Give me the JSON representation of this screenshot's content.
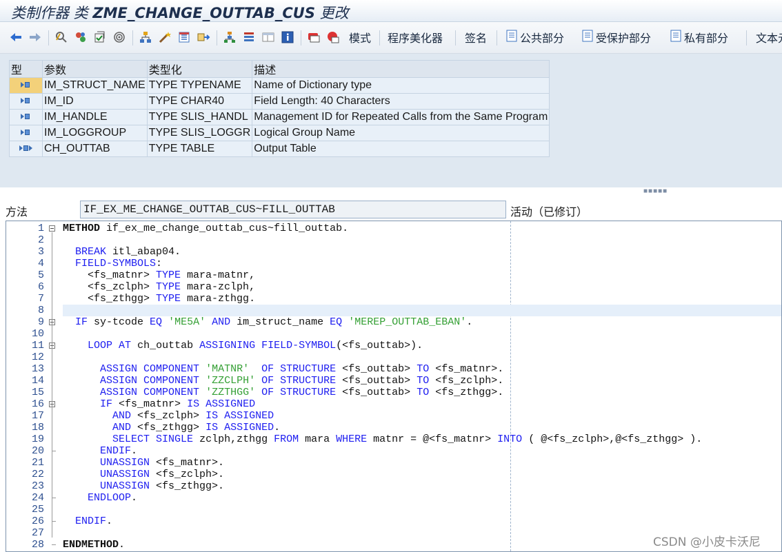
{
  "title": {
    "prefix": "类制作器 类 ",
    "class_name": "ZME_CHANGE_OUTTAB_CUS",
    "suffix": " 更改"
  },
  "toolbar": {
    "mode_label": "模式",
    "pretty_printer_label": "程序美化器",
    "signature_label": "签名",
    "public_section_label": "公共部分",
    "protected_section_label": "受保护部分",
    "private_section_label": "私有部分",
    "text_label": "文本元"
  },
  "params": {
    "headers": [
      "型",
      "参数",
      "类型化",
      "描述"
    ],
    "rows": [
      {
        "icon": "importing-param-icon",
        "name": "IM_STRUCT_NAME",
        "typing": "TYPE TYPENAME",
        "desc": "Name of Dictionary type"
      },
      {
        "icon": "importing-param-icon",
        "name": "IM_ID",
        "typing": "TYPE CHAR40",
        "desc": "Field Length: 40 Characters"
      },
      {
        "icon": "importing-param-icon",
        "name": "IM_HANDLE",
        "typing": "TYPE SLIS_HANDL",
        "desc": "Management ID for Repeated Calls from the Same Program"
      },
      {
        "icon": "importing-param-icon",
        "name": "IM_LOGGROUP",
        "typing": "TYPE SLIS_LOGGR",
        "desc": "Logical Group Name"
      },
      {
        "icon": "changing-param-icon",
        "name": "CH_OUTTAB",
        "typing": "TYPE TABLE",
        "desc": "Output Table"
      }
    ]
  },
  "method": {
    "label": "方法",
    "name": "IF_EX_ME_CHANGE_OUTTAB_CUS~FILL_OUTTAB",
    "status": "活动（已修订）"
  },
  "code_lines": [
    {
      "n": "1",
      "t": "METHOD if_ex_me_change_outtab_cus~fill_outtab."
    },
    {
      "n": "2",
      "t": ""
    },
    {
      "n": "3",
      "t": "  BREAK itl_abap04."
    },
    {
      "n": "4",
      "t": "  FIELD-SYMBOLS:"
    },
    {
      "n": "5",
      "t": "    <fs_matnr> TYPE mara-matnr,"
    },
    {
      "n": "6",
      "t": "    <fs_zclph> TYPE mara-zclph,"
    },
    {
      "n": "7",
      "t": "    <fs_zthgg> TYPE mara-zthgg."
    },
    {
      "n": "8",
      "t": ""
    },
    {
      "n": "9",
      "t": "  IF sy-tcode EQ 'ME5A' AND im_struct_name EQ 'MEREP_OUTTAB_EBAN'."
    },
    {
      "n": "10",
      "t": ""
    },
    {
      "n": "11",
      "t": "    LOOP AT ch_outtab ASSIGNING FIELD-SYMBOL(<fs_outtab>)."
    },
    {
      "n": "12",
      "t": ""
    },
    {
      "n": "13",
      "t": "      ASSIGN COMPONENT 'MATNR'  OF STRUCTURE <fs_outtab> TO <fs_matnr>."
    },
    {
      "n": "14",
      "t": "      ASSIGN COMPONENT 'ZZCLPH' OF STRUCTURE <fs_outtab> TO <fs_zclph>."
    },
    {
      "n": "15",
      "t": "      ASSIGN COMPONENT 'ZZTHGG' OF STRUCTURE <fs_outtab> TO <fs_zthgg>."
    },
    {
      "n": "16",
      "t": "      IF <fs_matnr> IS ASSIGNED"
    },
    {
      "n": "17",
      "t": "        AND <fs_zclph> IS ASSIGNED"
    },
    {
      "n": "18",
      "t": "        AND <fs_zthgg> IS ASSIGNED."
    },
    {
      "n": "19",
      "t": "        SELECT SINGLE zclph,zthgg FROM mara WHERE matnr = @<fs_matnr> INTO ( @<fs_zclph>,@<fs_zthgg> )."
    },
    {
      "n": "20",
      "t": "      ENDIF."
    },
    {
      "n": "21",
      "t": "      UNASSIGN <fs_matnr>."
    },
    {
      "n": "22",
      "t": "      UNASSIGN <fs_zclph>."
    },
    {
      "n": "23",
      "t": "      UNASSIGN <fs_zthgg>."
    },
    {
      "n": "24",
      "t": "    ENDLOOP."
    },
    {
      "n": "25",
      "t": ""
    },
    {
      "n": "26",
      "t": "  ENDIF."
    },
    {
      "n": "27",
      "t": ""
    },
    {
      "n": "28",
      "t": "ENDMETHOD."
    }
  ],
  "watermark": "CSDN @小皮卡沃尼"
}
